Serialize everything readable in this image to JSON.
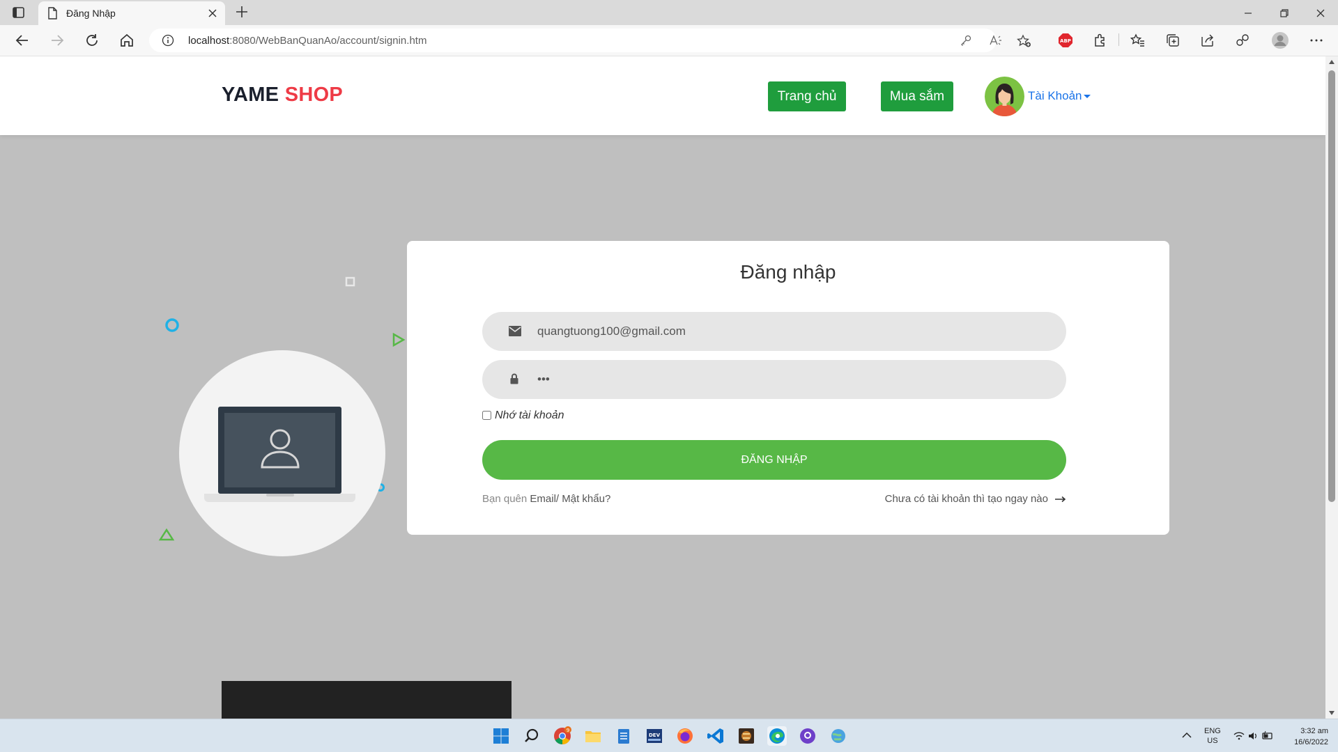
{
  "browser": {
    "tab_title": "Đăng Nhập",
    "url_host": "localhost",
    "url_rest": ":8080/WebBanQuanAo/account/signin.htm"
  },
  "header": {
    "brand_part1": "YAME",
    "brand_part2": "SHOP",
    "nav_home": "Trang chủ",
    "nav_shop": "Mua sắm",
    "account_label": "Tài Khoản"
  },
  "login": {
    "title": "Đăng nhập",
    "email_value": "quangtuong100@gmail.com",
    "password_value": "•••",
    "remember_label": "Nhớ tài khoản",
    "submit_label": "ĐĂNG NHẬP",
    "forgot_prefix": "Bạn quên",
    "forgot_link": "Email/ Mật khẩu?",
    "signup_text": "Chưa có tài khoản thì tạo ngay nào"
  },
  "taskbar": {
    "lang_line1": "ENG",
    "lang_line2": "US",
    "time": "3:32 am",
    "date": "16/6/2022",
    "chrome_badge": "9"
  },
  "colors": {
    "brand_dark": "#1a1f2c",
    "brand_red": "#ee3b46",
    "nav_green": "#1f9d3d",
    "login_green": "#57b846",
    "account_blue": "#1a73e8"
  }
}
